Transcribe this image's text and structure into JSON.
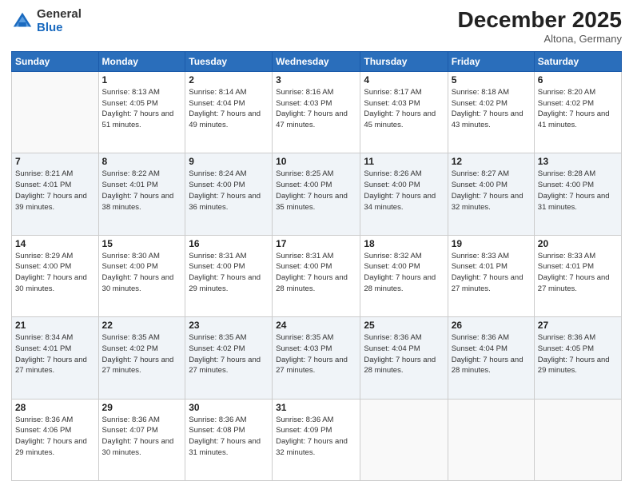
{
  "header": {
    "logo_general": "General",
    "logo_blue": "Blue",
    "month_title": "December 2025",
    "location": "Altona, Germany"
  },
  "days_of_week": [
    "Sunday",
    "Monday",
    "Tuesday",
    "Wednesday",
    "Thursday",
    "Friday",
    "Saturday"
  ],
  "weeks": [
    [
      {
        "day": "",
        "sunrise": "",
        "sunset": "",
        "daylight": "",
        "empty": true
      },
      {
        "day": "1",
        "sunrise": "Sunrise: 8:13 AM",
        "sunset": "Sunset: 4:05 PM",
        "daylight": "Daylight: 7 hours and 51 minutes.",
        "empty": false
      },
      {
        "day": "2",
        "sunrise": "Sunrise: 8:14 AM",
        "sunset": "Sunset: 4:04 PM",
        "daylight": "Daylight: 7 hours and 49 minutes.",
        "empty": false
      },
      {
        "day": "3",
        "sunrise": "Sunrise: 8:16 AM",
        "sunset": "Sunset: 4:03 PM",
        "daylight": "Daylight: 7 hours and 47 minutes.",
        "empty": false
      },
      {
        "day": "4",
        "sunrise": "Sunrise: 8:17 AM",
        "sunset": "Sunset: 4:03 PM",
        "daylight": "Daylight: 7 hours and 45 minutes.",
        "empty": false
      },
      {
        "day": "5",
        "sunrise": "Sunrise: 8:18 AM",
        "sunset": "Sunset: 4:02 PM",
        "daylight": "Daylight: 7 hours and 43 minutes.",
        "empty": false
      },
      {
        "day": "6",
        "sunrise": "Sunrise: 8:20 AM",
        "sunset": "Sunset: 4:02 PM",
        "daylight": "Daylight: 7 hours and 41 minutes.",
        "empty": false
      }
    ],
    [
      {
        "day": "7",
        "sunrise": "Sunrise: 8:21 AM",
        "sunset": "Sunset: 4:01 PM",
        "daylight": "Daylight: 7 hours and 39 minutes.",
        "empty": false
      },
      {
        "day": "8",
        "sunrise": "Sunrise: 8:22 AM",
        "sunset": "Sunset: 4:01 PM",
        "daylight": "Daylight: 7 hours and 38 minutes.",
        "empty": false
      },
      {
        "day": "9",
        "sunrise": "Sunrise: 8:24 AM",
        "sunset": "Sunset: 4:00 PM",
        "daylight": "Daylight: 7 hours and 36 minutes.",
        "empty": false
      },
      {
        "day": "10",
        "sunrise": "Sunrise: 8:25 AM",
        "sunset": "Sunset: 4:00 PM",
        "daylight": "Daylight: 7 hours and 35 minutes.",
        "empty": false
      },
      {
        "day": "11",
        "sunrise": "Sunrise: 8:26 AM",
        "sunset": "Sunset: 4:00 PM",
        "daylight": "Daylight: 7 hours and 34 minutes.",
        "empty": false
      },
      {
        "day": "12",
        "sunrise": "Sunrise: 8:27 AM",
        "sunset": "Sunset: 4:00 PM",
        "daylight": "Daylight: 7 hours and 32 minutes.",
        "empty": false
      },
      {
        "day": "13",
        "sunrise": "Sunrise: 8:28 AM",
        "sunset": "Sunset: 4:00 PM",
        "daylight": "Daylight: 7 hours and 31 minutes.",
        "empty": false
      }
    ],
    [
      {
        "day": "14",
        "sunrise": "Sunrise: 8:29 AM",
        "sunset": "Sunset: 4:00 PM",
        "daylight": "Daylight: 7 hours and 30 minutes.",
        "empty": false
      },
      {
        "day": "15",
        "sunrise": "Sunrise: 8:30 AM",
        "sunset": "Sunset: 4:00 PM",
        "daylight": "Daylight: 7 hours and 30 minutes.",
        "empty": false
      },
      {
        "day": "16",
        "sunrise": "Sunrise: 8:31 AM",
        "sunset": "Sunset: 4:00 PM",
        "daylight": "Daylight: 7 hours and 29 minutes.",
        "empty": false
      },
      {
        "day": "17",
        "sunrise": "Sunrise: 8:31 AM",
        "sunset": "Sunset: 4:00 PM",
        "daylight": "Daylight: 7 hours and 28 minutes.",
        "empty": false
      },
      {
        "day": "18",
        "sunrise": "Sunrise: 8:32 AM",
        "sunset": "Sunset: 4:00 PM",
        "daylight": "Daylight: 7 hours and 28 minutes.",
        "empty": false
      },
      {
        "day": "19",
        "sunrise": "Sunrise: 8:33 AM",
        "sunset": "Sunset: 4:01 PM",
        "daylight": "Daylight: 7 hours and 27 minutes.",
        "empty": false
      },
      {
        "day": "20",
        "sunrise": "Sunrise: 8:33 AM",
        "sunset": "Sunset: 4:01 PM",
        "daylight": "Daylight: 7 hours and 27 minutes.",
        "empty": false
      }
    ],
    [
      {
        "day": "21",
        "sunrise": "Sunrise: 8:34 AM",
        "sunset": "Sunset: 4:01 PM",
        "daylight": "Daylight: 7 hours and 27 minutes.",
        "empty": false
      },
      {
        "day": "22",
        "sunrise": "Sunrise: 8:35 AM",
        "sunset": "Sunset: 4:02 PM",
        "daylight": "Daylight: 7 hours and 27 minutes.",
        "empty": false
      },
      {
        "day": "23",
        "sunrise": "Sunrise: 8:35 AM",
        "sunset": "Sunset: 4:02 PM",
        "daylight": "Daylight: 7 hours and 27 minutes.",
        "empty": false
      },
      {
        "day": "24",
        "sunrise": "Sunrise: 8:35 AM",
        "sunset": "Sunset: 4:03 PM",
        "daylight": "Daylight: 7 hours and 27 minutes.",
        "empty": false
      },
      {
        "day": "25",
        "sunrise": "Sunrise: 8:36 AM",
        "sunset": "Sunset: 4:04 PM",
        "daylight": "Daylight: 7 hours and 28 minutes.",
        "empty": false
      },
      {
        "day": "26",
        "sunrise": "Sunrise: 8:36 AM",
        "sunset": "Sunset: 4:04 PM",
        "daylight": "Daylight: 7 hours and 28 minutes.",
        "empty": false
      },
      {
        "day": "27",
        "sunrise": "Sunrise: 8:36 AM",
        "sunset": "Sunset: 4:05 PM",
        "daylight": "Daylight: 7 hours and 29 minutes.",
        "empty": false
      }
    ],
    [
      {
        "day": "28",
        "sunrise": "Sunrise: 8:36 AM",
        "sunset": "Sunset: 4:06 PM",
        "daylight": "Daylight: 7 hours and 29 minutes.",
        "empty": false
      },
      {
        "day": "29",
        "sunrise": "Sunrise: 8:36 AM",
        "sunset": "Sunset: 4:07 PM",
        "daylight": "Daylight: 7 hours and 30 minutes.",
        "empty": false
      },
      {
        "day": "30",
        "sunrise": "Sunrise: 8:36 AM",
        "sunset": "Sunset: 4:08 PM",
        "daylight": "Daylight: 7 hours and 31 minutes.",
        "empty": false
      },
      {
        "day": "31",
        "sunrise": "Sunrise: 8:36 AM",
        "sunset": "Sunset: 4:09 PM",
        "daylight": "Daylight: 7 hours and 32 minutes.",
        "empty": false
      },
      {
        "day": "",
        "sunrise": "",
        "sunset": "",
        "daylight": "",
        "empty": true
      },
      {
        "day": "",
        "sunrise": "",
        "sunset": "",
        "daylight": "",
        "empty": true
      },
      {
        "day": "",
        "sunrise": "",
        "sunset": "",
        "daylight": "",
        "empty": true
      }
    ]
  ]
}
